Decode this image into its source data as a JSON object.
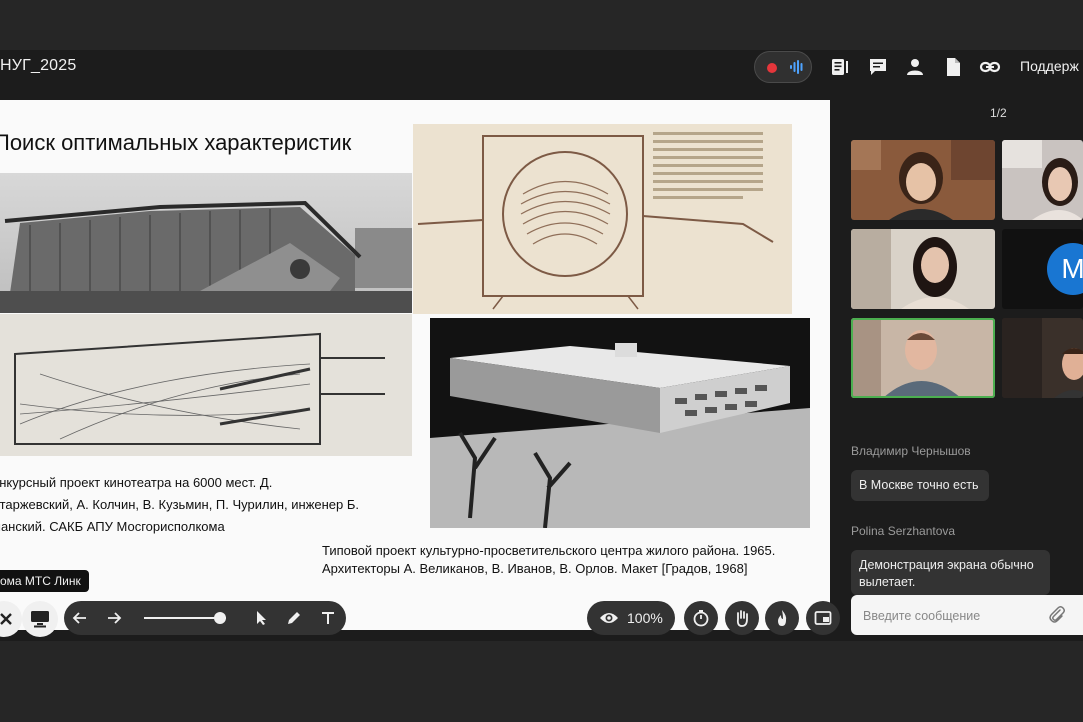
{
  "header": {
    "title": "НУГ_2025",
    "support_label": "Поддерж"
  },
  "slide": {
    "title": "Поиск оптимальных характеристик",
    "caption1": [
      "онкурсный проект кинотеатра на 6000 мест. Д.",
      "лтаржевский, А. Колчин, В. Кузьмин, П. Чурилин, инженер Б.",
      "манский. САКБ АПУ Мосгорисполкома"
    ],
    "caption2": [
      "Типовой проект культурно-просветительского центра жилого района. 1965.",
      "Архитекторы А. Великанов, В. Иванов, В. Орлов. Макет [Градов, 1968]"
    ]
  },
  "tooltip": "ома МТС Линк",
  "toolbar": {
    "zoom": "100%"
  },
  "participants": {
    "page": "1/2",
    "avatar_letter": "M"
  },
  "chat": {
    "messages": [
      {
        "sender": "Владимир Чернышов",
        "text": "В Москве точно есть"
      },
      {
        "sender": "Polina Serzhantova",
        "text": "Демонстрация экрана обычно вылетает."
      }
    ],
    "input_placeholder": "Введите сообщение"
  },
  "colors": {
    "record": "#e5363b",
    "active_speaker": "#4caf50",
    "avatar": "#1976d2"
  }
}
